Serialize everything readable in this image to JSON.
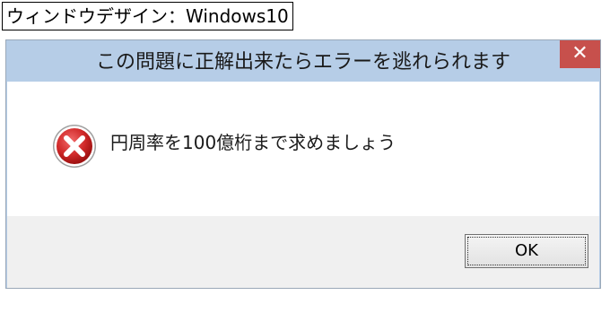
{
  "design_label": "ウィンドウデザイン：Windows10",
  "dialog": {
    "title": "この問題に正解出来たらエラーを逃れられます",
    "close_label": "✕",
    "message": "円周率を100億桁まで求めましょう",
    "ok_label": "OK",
    "icon": "error-x-icon",
    "colors": {
      "titlebar": "#b6cde7",
      "close_button": "#c7504c",
      "footer": "#f0f0f0",
      "icon_red": "#c81e1e"
    }
  }
}
